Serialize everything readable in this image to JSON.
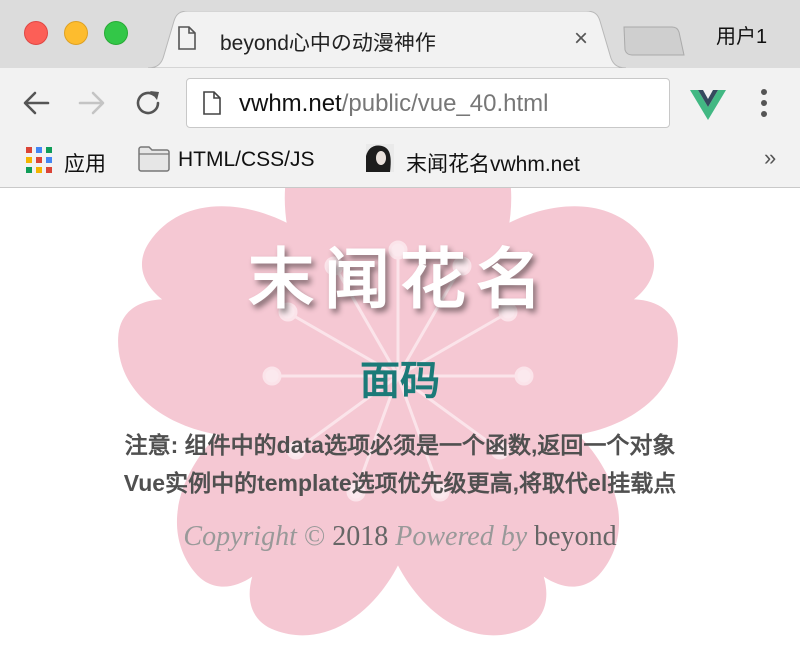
{
  "browser": {
    "tab": {
      "title": "beyond心中の动漫神作",
      "close": "×"
    },
    "profile": "用户1",
    "url": {
      "host": "vwhm.net",
      "path": "/public/vue_40.html"
    },
    "bookmarks": [
      {
        "label": "应用",
        "icon": "apps-grid-icon"
      },
      {
        "label": "HTML/CSS/JS",
        "icon": "folder-icon"
      },
      {
        "label": "末闻花名vwhm.net",
        "icon": "avatar-icon"
      }
    ],
    "more": "»"
  },
  "page": {
    "title": "末闻花名",
    "subtitle": "面码",
    "notes": [
      "注意: 组件中的data选项必须是一个函数,返回一个对象",
      "Vue实例中的template选项优先级更高,将取代el挂载点"
    ],
    "copyright": {
      "copyright_word": "Copyright",
      "symbol": "©",
      "year": "2018",
      "powered": "Powered by",
      "author": "beyond"
    }
  },
  "colors": {
    "accent": "#1b7a78",
    "blossom": "#f5c8d3",
    "tab_bg": "#f2f2f2",
    "strip_bg": "#dcdcdc"
  }
}
